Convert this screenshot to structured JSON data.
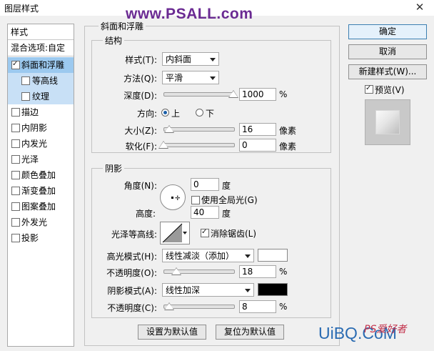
{
  "window": {
    "title": "图层样式",
    "close_label": "✕"
  },
  "watermark": "www.PSALL.com",
  "sidebar": {
    "head1": "样式",
    "head2": "混合选项:自定",
    "items": [
      {
        "label": "斜面和浮雕",
        "checked": true
      },
      {
        "label": "等高线",
        "checked": false
      },
      {
        "label": "纹理",
        "checked": false
      },
      {
        "label": "描边",
        "checked": false
      },
      {
        "label": "内阴影",
        "checked": false
      },
      {
        "label": "内发光",
        "checked": false
      },
      {
        "label": "光泽",
        "checked": false
      },
      {
        "label": "颜色叠加",
        "checked": false
      },
      {
        "label": "渐变叠加",
        "checked": false
      },
      {
        "label": "图案叠加",
        "checked": false
      },
      {
        "label": "外发光",
        "checked": false
      },
      {
        "label": "投影",
        "checked": false
      }
    ]
  },
  "bevel": {
    "title": "斜面和浮雕",
    "structure_title": "结构",
    "style_label": "样式(T):",
    "style_value": "内斜面",
    "method_label": "方法(Q):",
    "method_value": "平滑",
    "depth_label": "深度(D):",
    "depth_value": "1000",
    "depth_unit": "%",
    "depth_level": 1.0,
    "direction_label": "方向:",
    "dir_up": "上",
    "dir_down": "下",
    "size_label": "大小(Z):",
    "size_value": "16",
    "size_unit": "像素",
    "size_level": 0.08,
    "soften_label": "软化(F):",
    "soften_value": "0",
    "soften_unit": "像素",
    "soften_level": 0.0
  },
  "shading": {
    "title": "阴影",
    "angle_label": "角度(N):",
    "angle_value": "0",
    "angle_unit": "度",
    "global_light_label": "使用全局光(G)",
    "altitude_label": "高度:",
    "altitude_value": "40",
    "altitude_unit": "度",
    "gloss_label": "光泽等高线:",
    "antialias_label": "消除锯齿(L)",
    "highlight_mode_label": "高光模式(H):",
    "highlight_mode_value": "线性减淡（添加）",
    "highlight_color": "#ffffff",
    "opacity1_label": "不透明度(O):",
    "opacity1_value": "18",
    "opacity1_unit": "%",
    "opacity1_level": 0.18,
    "shadow_mode_label": "阴影模式(A):",
    "shadow_mode_value": "线性加深",
    "shadow_color": "#000000",
    "opacity2_label": "不透明度(C):",
    "opacity2_value": "8",
    "opacity2_unit": "%",
    "opacity2_level": 0.08
  },
  "footer": {
    "make_default": "设置为默认值",
    "reset_default": "复位为默认值"
  },
  "right": {
    "ok": "确定",
    "cancel": "取消",
    "new_style": "新建样式(W)...",
    "preview_label": "预览(V)"
  },
  "brand": {
    "logo": "UiBQ.CoM",
    "ps_mark": "PS爱好者"
  }
}
